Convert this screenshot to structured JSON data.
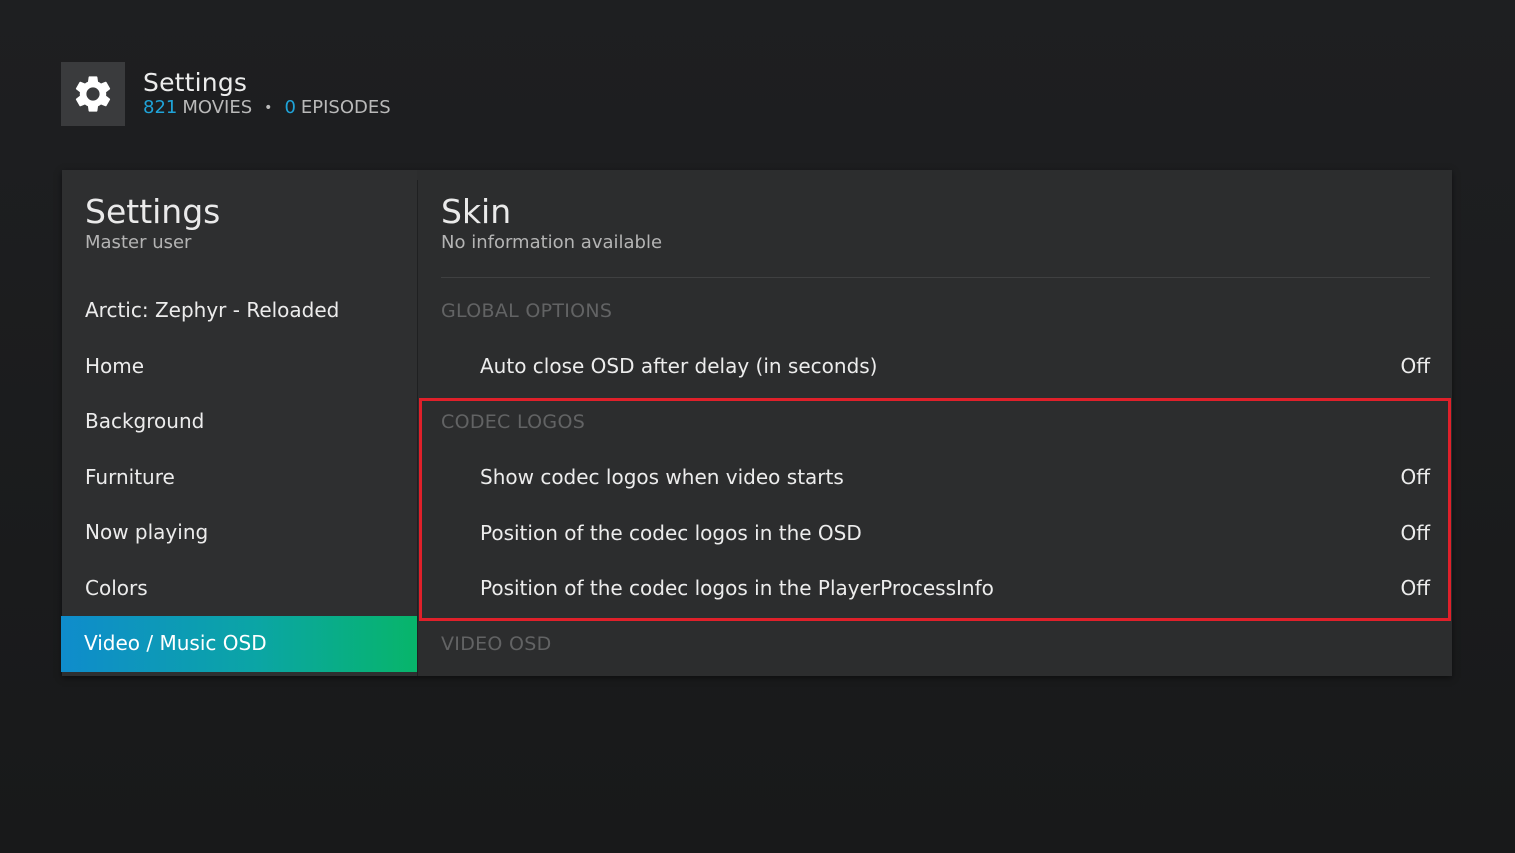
{
  "header": {
    "title": "Settings",
    "movies_count": "821",
    "movies_label": "MOVIES",
    "dot": "•",
    "episodes_count": "0",
    "episodes_label": "EPISODES",
    "icon": "gear-icon"
  },
  "sidebar": {
    "title": "Settings",
    "subtitle": "Master user",
    "items": [
      {
        "label": "Arctic: Zephyr - Reloaded",
        "active": false
      },
      {
        "label": "Home",
        "active": false
      },
      {
        "label": "Background",
        "active": false
      },
      {
        "label": "Furniture",
        "active": false
      },
      {
        "label": "Now playing",
        "active": false
      },
      {
        "label": "Colors",
        "active": false
      },
      {
        "label": "Video / Music OSD",
        "active": true
      }
    ]
  },
  "content": {
    "title": "Skin",
    "subtitle": "No information available",
    "sections": {
      "global": "GLOBAL OPTIONS",
      "codec": "CODEC LOGOS",
      "video_osd": "VIDEO OSD"
    },
    "settings": {
      "auto_close": {
        "label": "Auto close OSD after delay (in seconds)",
        "value": "Off"
      },
      "show_codec": {
        "label": "Show codec logos when video starts",
        "value": "Off"
      },
      "pos_osd": {
        "label": "Position of the codec logos in the OSD",
        "value": "Off"
      },
      "pos_ppi": {
        "label": "Position of the codec logos in the PlayerProcessInfo",
        "value": "Off"
      }
    }
  },
  "colors": {
    "accent_blue": "#1fa3d8",
    "active_gradient_start": "#0f8ccc",
    "active_gradient_end": "#07b56a",
    "highlight_box": "#e0202a"
  }
}
